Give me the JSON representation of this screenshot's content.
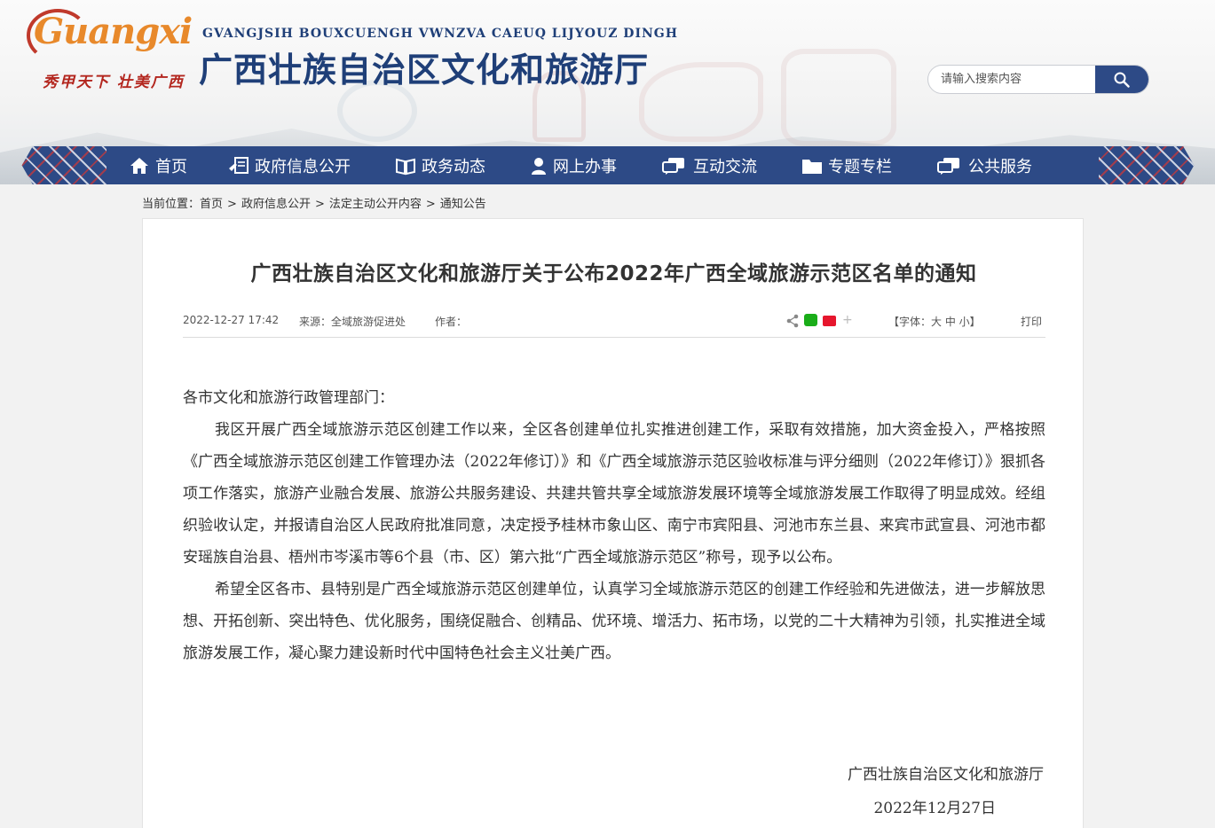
{
  "header": {
    "logo_word": "Guangxi",
    "slogan": "秀甲天下 壮美广西",
    "site_subtitle": "GVANGJSIH BOUXCUENGH VWNZVA CAEUQ LIJYOUZ DINGH",
    "site_title": "广西壮族自治区文化和旅游厅",
    "search": {
      "placeholder": "请输入搜索内容"
    }
  },
  "nav": {
    "items": [
      {
        "label": "首页",
        "icon": "home-icon"
      },
      {
        "label": "政府信息公开",
        "icon": "document-icon"
      },
      {
        "label": "政务动态",
        "icon": "book-icon"
      },
      {
        "label": "网上办事",
        "icon": "user-icon"
      },
      {
        "label": "互动交流",
        "icon": "chat-icon"
      },
      {
        "label": "专题专栏",
        "icon": "folder-icon"
      },
      {
        "label": "公共服务",
        "icon": "service-icon"
      }
    ]
  },
  "breadcrumb": {
    "prefix": "当前位置：",
    "items": [
      "首页",
      "政府信息公开",
      "法定主动公开内容",
      "通知公告"
    ],
    "separator": ">"
  },
  "article": {
    "title": "广西壮族自治区文化和旅游厅关于公布2022年广西全域旅游示范区名单的通知",
    "datetime": "2022-12-27 17:42",
    "source_label": "来源：全域旅游促进处",
    "author_label": "作者：",
    "font_size_label": "【字体：大 中 小】",
    "print_label": "打印",
    "salutation": "各市文化和旅游行政管理部门：",
    "para1": "我区开展广西全域旅游示范区创建工作以来，全区各创建单位扎实推进创建工作，采取有效措施，加大资金投入，严格按照《广西全域旅游示范区创建工作管理办法（2022年修订）》和《广西全域旅游示范区验收标准与评分细则（2022年修订）》狠抓各项工作落实，旅游产业融合发展、旅游公共服务建设、共建共管共享全域旅游发展环境等全域旅游发展工作取得了明显成效。经组织验收认定，并报请自治区人民政府批准同意，决定授予桂林市象山区、南宁市宾阳县、河池市东兰县、来宾市武宣县、河池市都安瑶族自治县、梧州市岑溪市等6个县（市、区）第六批“广西全域旅游示范区”称号，现予以公布。",
    "para2": "希望全区各市、县特别是广西全域旅游示范区创建单位，认真学习全域旅游示范区的创建工作经验和先进做法，进一步解放思想、开拓创新、突出特色、优化服务，围绕促融合、创精品、优环境、增活力、拓市场，以党的二十大精神为引领，扎实推进全域旅游发展工作，凝心聚力建设新时代中国特色社会主义壮美广西。",
    "signature": "广西壮族自治区文化和旅游厅",
    "sign_date": "2022年12月27日"
  },
  "colors": {
    "nav_bg": "#2d4a86",
    "title_blue": "#1f3f78",
    "logo_red": "#b3261e"
  }
}
